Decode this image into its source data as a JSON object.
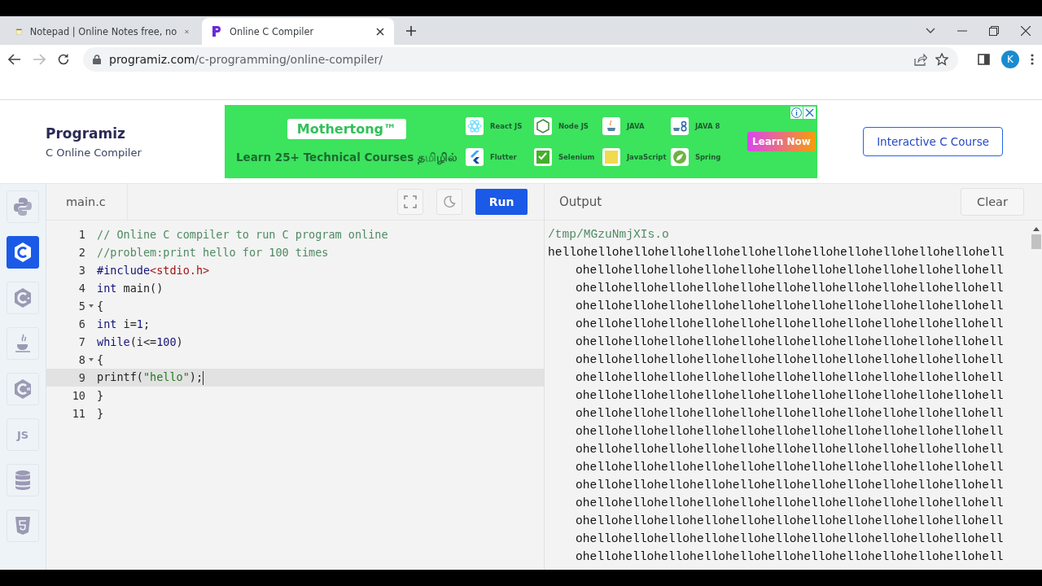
{
  "browser": {
    "tabs": [
      {
        "title": "Notepad | Online Notes free, no",
        "kind": "notepad",
        "selected": false
      },
      {
        "title": "Online C Compiler",
        "kind": "programiz",
        "selected": true
      }
    ],
    "nav": {
      "forward_enabled": false
    },
    "address": {
      "host": "programiz.com",
      "path": "/c-programming/online-compiler/"
    },
    "profile": {
      "initial": "K"
    }
  },
  "site": {
    "logo": "Programiz",
    "subtitle": "C Online Compiler",
    "course_button": "Interactive C Course"
  },
  "ad": {
    "brand": "Mothertong™",
    "tagline": "Learn 25+ Technical Courses தமிழில்",
    "cta": "Learn Now",
    "courses": [
      {
        "name": "React JS",
        "kind": "react"
      },
      {
        "name": "Node JS",
        "kind": "node"
      },
      {
        "name": "JAVA",
        "kind": "java"
      },
      {
        "name": "JAVA 8",
        "kind": "java8"
      },
      {
        "name": "Flutter",
        "kind": "flutter"
      },
      {
        "name": "Selenium",
        "kind": "selenium"
      },
      {
        "name": "JavaScript",
        "kind": "javascript"
      },
      {
        "name": "Spring",
        "kind": "spring"
      }
    ]
  },
  "sidebar": {
    "items": [
      {
        "kind": "python",
        "selected": false
      },
      {
        "kind": "c",
        "selected": true
      },
      {
        "kind": "cpp",
        "selected": false
      },
      {
        "kind": "java",
        "selected": false
      },
      {
        "kind": "csharp",
        "selected": false
      },
      {
        "kind": "js",
        "label": "JS",
        "selected": false
      },
      {
        "kind": "sql",
        "selected": false
      },
      {
        "kind": "html",
        "selected": false
      }
    ]
  },
  "editor": {
    "file": "main.c",
    "run": "Run",
    "lines": [
      {
        "number": "1",
        "foldable": false,
        "active": false,
        "tokens": [
          {
            "kind": "comment",
            "text": "// Online C compiler to run C program online"
          }
        ]
      },
      {
        "number": "2",
        "foldable": false,
        "active": false,
        "tokens": [
          {
            "kind": "comment",
            "text": "//problem:print hello for 100 times"
          }
        ]
      },
      {
        "number": "3",
        "foldable": false,
        "active": false,
        "tokens": [
          {
            "kind": "keyword",
            "text": "#include"
          },
          {
            "kind": "header",
            "text": "<stdio.h>"
          }
        ]
      },
      {
        "number": "4",
        "foldable": false,
        "active": false,
        "tokens": [
          {
            "kind": "keyword",
            "text": "int"
          },
          {
            "kind": "plain",
            "text": " main()"
          }
        ]
      },
      {
        "number": "5",
        "foldable": true,
        "active": false,
        "tokens": [
          {
            "kind": "plain",
            "text": "{"
          }
        ]
      },
      {
        "number": "6",
        "foldable": false,
        "active": false,
        "tokens": [
          {
            "kind": "keyword",
            "text": "int"
          },
          {
            "kind": "plain",
            "text": " i="
          },
          {
            "kind": "number",
            "text": "1"
          },
          {
            "kind": "plain",
            "text": ";"
          }
        ]
      },
      {
        "number": "7",
        "foldable": false,
        "active": false,
        "tokens": [
          {
            "kind": "keyword",
            "text": "while"
          },
          {
            "kind": "plain",
            "text": "(i<="
          },
          {
            "kind": "number",
            "text": "100"
          },
          {
            "kind": "plain",
            "text": ")"
          }
        ]
      },
      {
        "number": "8",
        "foldable": true,
        "active": false,
        "tokens": [
          {
            "kind": "plain",
            "text": "{"
          }
        ]
      },
      {
        "number": "9",
        "foldable": false,
        "active": true,
        "tokens": [
          {
            "kind": "plain",
            "text": "printf("
          },
          {
            "kind": "string",
            "text": "\"hello\""
          },
          {
            "kind": "plain",
            "text": ");"
          }
        ]
      },
      {
        "number": "10",
        "foldable": false,
        "active": false,
        "tokens": [
          {
            "kind": "plain",
            "text": "}"
          }
        ]
      },
      {
        "number": "11",
        "foldable": false,
        "active": false,
        "tokens": [
          {
            "kind": "plain",
            "text": "}"
          }
        ]
      }
    ]
  },
  "output": {
    "title": "Output",
    "clear": "Clear",
    "lines": [
      {
        "kind": "path",
        "text": "/tmp/MGzuNmjXIs.o"
      },
      {
        "kind": "first",
        "text": "hellohellohellohellohellohellohellohellohellohellohellohellohell"
      },
      {
        "kind": "wrap",
        "text": "ohellohellohellohellohellohellohellohellohellohellohellohell"
      },
      {
        "kind": "wrap",
        "text": "ohellohellohellohellohellohellohellohellohellohellohellohell"
      },
      {
        "kind": "wrap",
        "text": "ohellohellohellohellohellohellohellohellohellohellohellohell"
      },
      {
        "kind": "wrap",
        "text": "ohellohellohellohellohellohellohellohellohellohellohellohell"
      },
      {
        "kind": "wrap",
        "text": "ohellohellohellohellohellohellohellohellohellohellohellohell"
      },
      {
        "kind": "wrap",
        "text": "ohellohellohellohellohellohellohellohellohellohellohellohell"
      },
      {
        "kind": "wrap",
        "text": "ohellohellohellohellohellohellohellohellohellohellohellohell"
      },
      {
        "kind": "wrap",
        "text": "ohellohellohellohellohellohellohellohellohellohellohellohell"
      },
      {
        "kind": "wrap",
        "text": "ohellohellohellohellohellohellohellohellohellohellohellohell"
      },
      {
        "kind": "wrap",
        "text": "ohellohellohellohellohellohellohellohellohellohellohellohell"
      },
      {
        "kind": "wrap",
        "text": "ohellohellohellohellohellohellohellohellohellohellohellohell"
      },
      {
        "kind": "wrap",
        "text": "ohellohellohellohellohellohellohellohellohellohellohellohell"
      },
      {
        "kind": "wrap",
        "text": "ohellohellohellohellohellohellohellohellohellohellohellohell"
      },
      {
        "kind": "wrap",
        "text": "ohellohellohellohellohellohellohellohellohellohellohellohell"
      },
      {
        "kind": "wrap",
        "text": "ohellohellohellohellohellohellohellohellohellohellohellohell"
      },
      {
        "kind": "wrap",
        "text": "ohellohellohellohellohellohellohellohellohellohellohellohell"
      },
      {
        "kind": "wrap",
        "text": "ohellohellohellohellohellohellohellohellohellohellohellohell"
      }
    ]
  }
}
